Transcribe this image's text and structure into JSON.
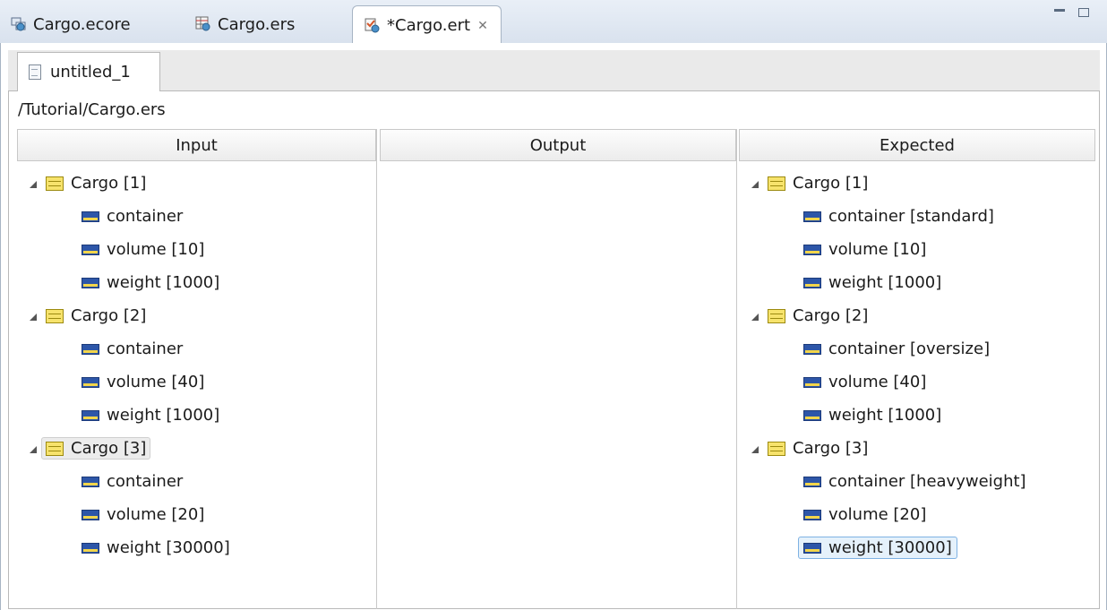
{
  "tabs": [
    {
      "label": "Cargo.ecore",
      "icon": "ecore-model-icon"
    },
    {
      "label": "Cargo.ers",
      "icon": "ruleset-icon"
    },
    {
      "label": "*Cargo.ert",
      "icon": "ruletest-icon",
      "close": "✕"
    }
  ],
  "subtab": {
    "label": "untitled_1",
    "icon": "document-icon"
  },
  "path": "/Tutorial/Cargo.ers",
  "columns": {
    "input": {
      "header": "Input",
      "items": [
        {
          "label": "Cargo [1]",
          "children": [
            "container",
            "volume [10]",
            "weight [1000]"
          ]
        },
        {
          "label": "Cargo [2]",
          "children": [
            "container",
            "volume [40]",
            "weight [1000]"
          ]
        },
        {
          "label": "Cargo [3]",
          "children": [
            "container",
            "volume [20]",
            "weight [30000]"
          ]
        }
      ]
    },
    "output": {
      "header": "Output",
      "items": []
    },
    "expected": {
      "header": "Expected",
      "items": [
        {
          "label": "Cargo [1]",
          "children": [
            "container [standard]",
            "volume [10]",
            "weight [1000]"
          ]
        },
        {
          "label": "Cargo [2]",
          "children": [
            "container [oversize]",
            "volume [40]",
            "weight [1000]"
          ]
        },
        {
          "label": "Cargo [3]",
          "children": [
            "container [heavyweight]",
            "volume [20]",
            "weight [30000]"
          ]
        }
      ]
    }
  },
  "colors": {
    "class_icon": "#f7e36c",
    "attribute_icon": "#2d56a8",
    "selection": "#e5f1fb"
  }
}
